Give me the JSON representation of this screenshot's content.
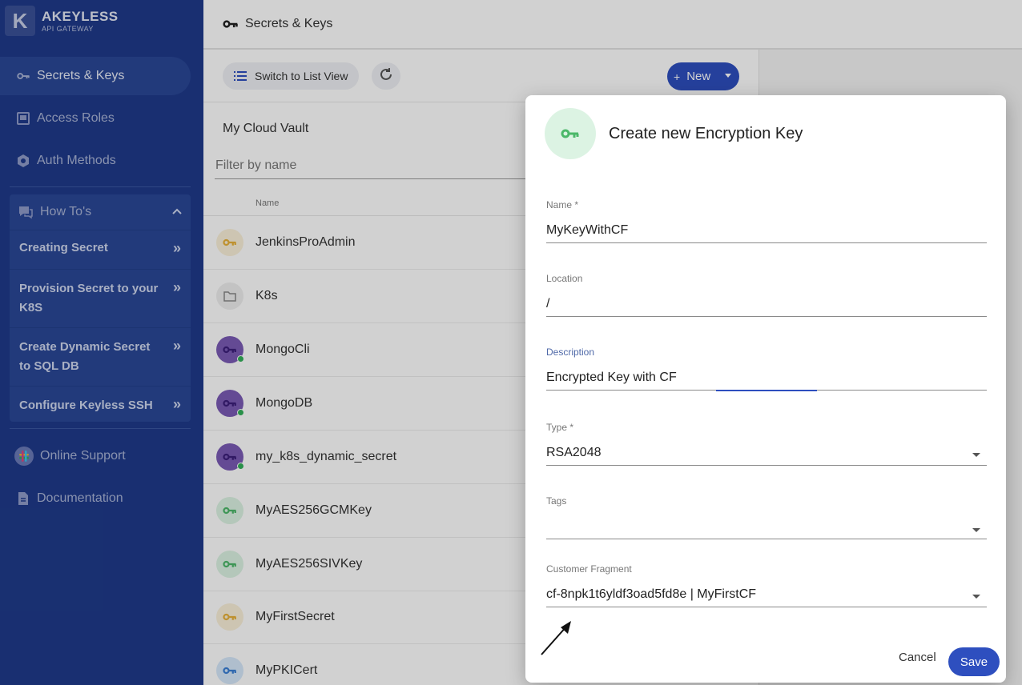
{
  "brand": {
    "mark": "K",
    "title": "AKEYLESS",
    "subtitle": "API GATEWAY"
  },
  "sidebar": {
    "items": [
      {
        "label": "Secrets & Keys",
        "icon": "key-icon",
        "active": true
      },
      {
        "label": "Access Roles",
        "icon": "badge-icon"
      },
      {
        "label": "Auth Methods",
        "icon": "gear-shield-icon"
      }
    ],
    "howto": {
      "label": "How To's",
      "items": [
        "Creating Secret",
        "Provision Secret to your K8S",
        "Create Dynamic Secret to SQL DB",
        "Configure Keyless SSH"
      ]
    },
    "footer": [
      {
        "label": "Online Support",
        "icon": "slack-icon"
      },
      {
        "label": "Documentation",
        "icon": "document-icon"
      }
    ]
  },
  "topbar": {
    "title": "Secrets & Keys"
  },
  "toolbar": {
    "list_view_label": "Switch to List View",
    "new_label": "New"
  },
  "vault": {
    "title": "My Cloud Vault",
    "filter_placeholder": "Filter by name",
    "column_name": "Name",
    "rows": [
      {
        "name": "JenkinsProAdmin",
        "type": "secret"
      },
      {
        "name": "K8s",
        "type": "folder"
      },
      {
        "name": "MongoCli",
        "type": "dynamic"
      },
      {
        "name": "MongoDB",
        "type": "dynamic"
      },
      {
        "name": "my_k8s_dynamic_secret",
        "type": "dynamic"
      },
      {
        "name": "MyAES256GCMKey",
        "type": "key"
      },
      {
        "name": "MyAES256SIVKey",
        "type": "key"
      },
      {
        "name": "MyFirstSecret",
        "type": "secret"
      },
      {
        "name": "MyPKICert",
        "type": "cert"
      }
    ]
  },
  "dialog": {
    "title": "Create new Encryption Key",
    "fields": {
      "name": {
        "label": "Name *",
        "value": "MyKeyWithCF"
      },
      "location": {
        "label": "Location",
        "value": "/"
      },
      "description": {
        "label": "Description",
        "value": "Encrypted Key with CF"
      },
      "type": {
        "label": "Type *",
        "value": "RSA2048"
      },
      "tags": {
        "label": "Tags",
        "value": ""
      },
      "customer_fragment": {
        "label": "Customer Fragment",
        "value": "cf-8npk1t6yldf3oad5fd8e | MyFirstCF"
      }
    },
    "cancel_label": "Cancel",
    "save_label": "Save"
  },
  "colors": {
    "sidebar_bg": "#1f3a8a",
    "accent": "#2e4fbf",
    "key_green": "#4cb86a",
    "secret_yellow": "#e8b13a",
    "dynamic_purple": "#6b3fb3"
  }
}
